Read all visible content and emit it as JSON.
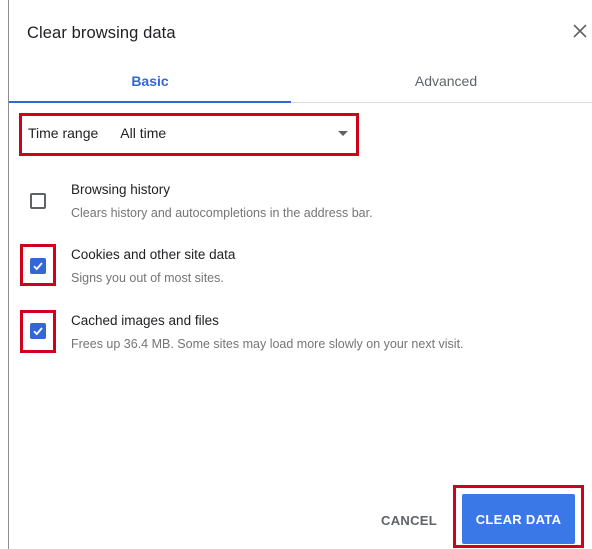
{
  "dialog": {
    "title": "Clear browsing data",
    "close_icon": "close-icon"
  },
  "tabs": [
    {
      "label": "Basic",
      "active": true
    },
    {
      "label": "Advanced",
      "active": false
    }
  ],
  "time_range": {
    "label": "Time range",
    "value": "All time",
    "dropdown_icon": "dropdown-arrow-icon"
  },
  "options": [
    {
      "title": "Browsing history",
      "description": "Clears history and autocompletions in the address bar.",
      "checked": false
    },
    {
      "title": "Cookies and other site data",
      "description": "Signs you out of most sites.",
      "checked": true
    },
    {
      "title": "Cached images and files",
      "description": "Frees up 36.4 MB. Some sites may load more slowly on your next visit.",
      "checked": true
    }
  ],
  "buttons": {
    "cancel": "CANCEL",
    "clear": "CLEAR DATA"
  },
  "colors": {
    "accent": "#3367d6",
    "button": "#3b78e7",
    "highlight": "#d0021b"
  }
}
